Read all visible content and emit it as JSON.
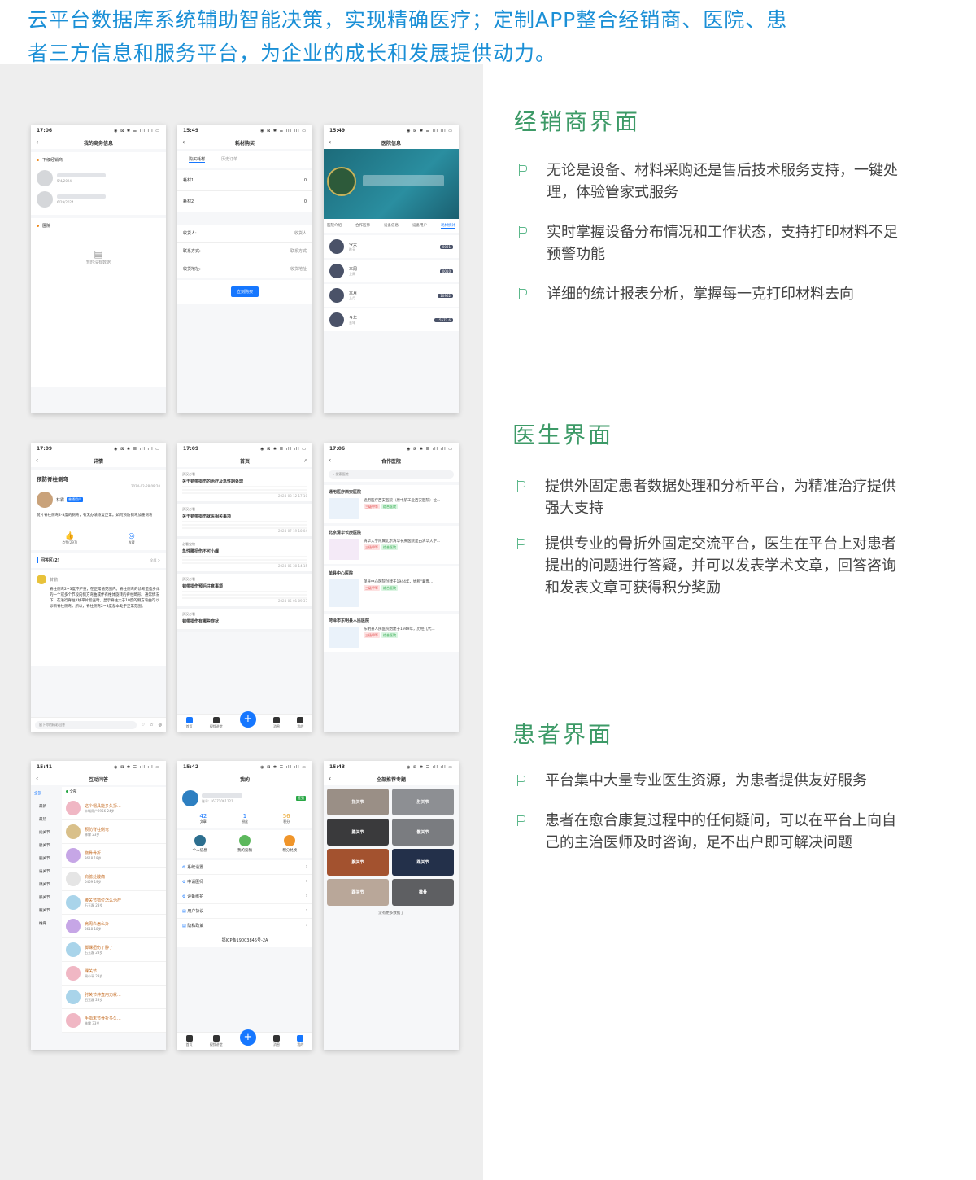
{
  "headline": {
    "line1": "云平台数据库系统辅助智能决策，实现精确医疗；定制APP整合经销商、医院、患",
    "line2": "者三方信息和服务平台，为企业的成长和发展提供动力。"
  },
  "sections": [
    {
      "title": "经销商界面",
      "bullets": [
        "无论是设备、材料采购还是售后技术服务支持，一键处理，体验管家式服务",
        "实时掌握设备分布情况和工作状态，支持打印材料不足预警功能",
        "详细的统计报表分析，掌握每一克打印材料去向"
      ]
    },
    {
      "title": "医生界面",
      "bullets": [
        "提供外固定患者数据处理和分析平台，为精准治疗提供强大支持",
        "提供专业的骨折外固定交流平台，医生在平台上对患者提出的问题进行答疑，并可以发表学术文章，回答咨询和发表文章可获得积分奖励"
      ]
    },
    {
      "title": "患者界面",
      "bullets": [
        "平台集中大量专业医生资源，为患者提供友好服务",
        "患者在愈合康复过程中的任何疑问，可以在平台上向自己的主治医师及时咨询，足不出户即可解决问题"
      ]
    }
  ],
  "status_icons": "◉ ⊠ ✱ ☰ ıll ıll ▭",
  "phones": {
    "p1": {
      "time": "17:06",
      "title": "我的商务信息",
      "sec1": "下级经销商",
      "d1": "5/4/2024",
      "d2": "6/29/2024",
      "sec2": "医院",
      "empty": "暂时没有数据"
    },
    "p2": {
      "time": "15:49",
      "title": "耗材购买",
      "tab1": "购买耗材",
      "tab2": "历史订单",
      "m1": "耗材1",
      "m2": "耗材2",
      "v": "0",
      "f1": "收货人:",
      "f1v": "收货人",
      "f2": "联系方式:",
      "f2v": "联系方式",
      "f3": "收货地址:",
      "f3v": "收货地址",
      "btn": "立刻购买"
    },
    "p3": {
      "time": "15:49",
      "title": "医院信息",
      "tabs": [
        "医院介绍",
        "合作医师",
        "设备信息",
        "设备用户",
        "耗材统计"
      ],
      "rows": [
        {
          "label": "今天",
          "sub": "昨天",
          "badge": "0001"
        },
        {
          "label": "本周",
          "sub": "上周",
          "badge": "0010"
        },
        {
          "label": "本月",
          "sub": "上月",
          "badge": "10962"
        },
        {
          "label": "今年",
          "sub": "去年",
          "badge": "15572.6"
        }
      ]
    },
    "p4": {
      "time": "17:09",
      "title": "详情",
      "heading": "预防脊柱侧弯",
      "date": "2024-02-28 09:20",
      "author": "林霖",
      "role": "普通用户",
      "body": "前片脊柱侧弯2-3度的侧弯，有无办法恢复正常。如何预防侧弯加重侧弯",
      "like": "点赞(297)",
      "collect": "收藏",
      "answers": "回答区(2)",
      "more": "全部 >",
      "answerer": "甘鹏",
      "answer": "脊柱侧弯2~3度不严重，在正常值范围内。脊柱侧弯的诊断是指身体的一个或多个节段向侧方弯曲或伴有椎体旋转的脊柱畸形。通常情况下，在进行脊柱X线平片检查时，显示脊柱大于10度的侧方弯曲可以诊断脊柱侧弯，所以，脊柱侧弯2~3度基本处于正常范围。",
      "reply": "留下你的精彩回答"
    },
    "p5": {
      "time": "17:09",
      "title": "首页",
      "news": [
        {
          "src": "武汉必看",
          "title": "关于韧带损伤的治疗及急性期处理",
          "meta": "2024-08-12 17:10"
        },
        {
          "src": "武汉必看",
          "title": "关于韧带损伤就医相关事项",
          "meta": "2024-07-19 10:04"
        },
        {
          "src": "必看宝物",
          "title": "急性腰扭伤不可小觑",
          "meta": "2024-05-30 14:15"
        },
        {
          "src": "武汉必看",
          "title": "韧带损伤预后注意事项",
          "meta": "2024-05-01 09:37"
        },
        {
          "src": "武汉必看",
          "title": "韧带损伤有哪些症状",
          "meta": ""
        }
      ],
      "nav": [
        "首页",
        "视频讲堂",
        "",
        "消息",
        "我的"
      ]
    },
    "p6": {
      "time": "17:06",
      "title": "合作医院",
      "search": "搜索医院",
      "hospitals": [
        {
          "name": "通用医疗西安医院",
          "desc": "通用医疗西安医院（原中航工业西安医院）位..."
        },
        {
          "name": "北京清华长庚医院",
          "desc": "清华大学附属北京清华长庚医院是由清华大学..."
        },
        {
          "name": "单县中心医院",
          "desc": "单县中心医院创建于1944年，始称\"冀鲁..."
        },
        {
          "name": "菏泽市东明县人民医院",
          "desc": "东明县人民医院始建于1949年，历经几代..."
        }
      ],
      "tag1": "三级甲等",
      "tag2": "综合医院"
    },
    "p7": {
      "time": "15:41",
      "title": "互动问答",
      "all": "全部",
      "cats": [
        "全部",
        "最新",
        "最热",
        "指关节",
        "肘关节",
        "腕关节",
        "肩关节",
        "踝关节",
        "膝关节",
        "髋关节",
        "椎骨"
      ],
      "items": [
        {
          "q": "这个帽具能多久拆...",
          "m": "丰城用户2956 24岁"
        },
        {
          "q": "预防脊柱侧弯",
          "m": "林霖 23岁"
        },
        {
          "q": "桡骨骨折",
          "m": "8618 18岁"
        },
        {
          "q": "肩膀处酸痛",
          "m": "0459 19岁"
        },
        {
          "q": "腰关节错位怎么治疗",
          "m": "石玉磊 23岁"
        },
        {
          "q": "肩周炎怎么办",
          "m": "8618 18岁"
        },
        {
          "q": "脚踝扭伤了肿了",
          "m": "石玉磊 23岁"
        },
        {
          "q": "踝关节",
          "m": "周小平 23岁"
        },
        {
          "q": "肘关节伸直用力就...",
          "m": "石玉磊 23岁"
        },
        {
          "q": "手指末节骨折多久...",
          "m": "林霖 33岁"
        }
      ]
    },
    "p8": {
      "time": "15:42",
      "title": "我的",
      "phone": "账号: 16371061121",
      "sign": "签到",
      "stats": [
        {
          "v": "42",
          "l": "文章"
        },
        {
          "v": "1",
          "l": "粉丝"
        },
        {
          "v": "56",
          "l": "积分"
        }
      ],
      "shortcuts": [
        "个人信息",
        "我的投稿",
        "积分兑换"
      ],
      "menu": [
        "系统设置",
        "申请医师",
        "设备维护",
        "用户协议",
        "隐私政策"
      ],
      "icp": "鄂ICP备19003845号-2A",
      "nav": [
        "首页",
        "视频讲堂",
        "",
        "消息",
        "我的"
      ]
    },
    "p9": {
      "time": "15:43",
      "title": "全部推荐专题",
      "tiles": [
        "指关节",
        "肘关节",
        "膝关节",
        "髋关节",
        "腕关节",
        "踝关节",
        "踝关节",
        "椎骨"
      ],
      "end": "没有更多数据了"
    }
  },
  "colors": {
    "headline": "#1a8fd6",
    "section_title": "#3d9a67",
    "accent_blue": "#1677ff"
  }
}
